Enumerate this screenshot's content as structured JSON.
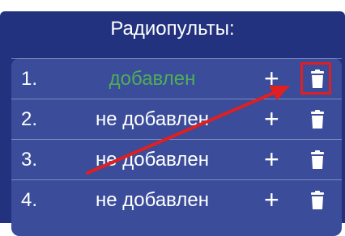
{
  "header": {
    "title": "Радиопульты:"
  },
  "remotes": [
    {
      "index": "1.",
      "status": "добавлен",
      "added": true
    },
    {
      "index": "2.",
      "status": "не добавлен",
      "added": false
    },
    {
      "index": "3.",
      "status": "не добавлен",
      "added": false
    },
    {
      "index": "4.",
      "status": "не добавлен",
      "added": false
    }
  ],
  "actions": {
    "add_label": "+",
    "add_icon": "plus-icon",
    "delete_icon": "trash-icon"
  },
  "colors": {
    "background": "#22327e",
    "panel": "#3a4c9a",
    "added_status": "#4fae57",
    "annotation": "#e02020"
  }
}
